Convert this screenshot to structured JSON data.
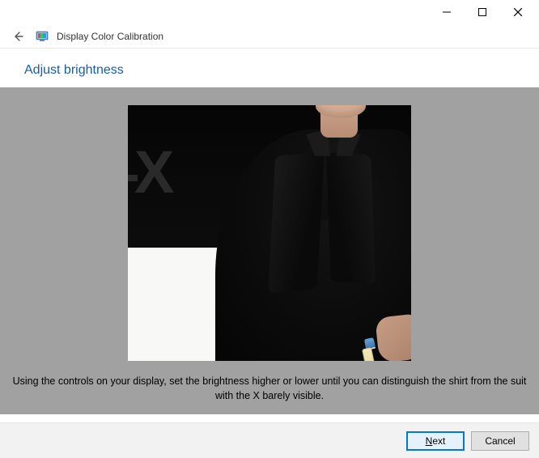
{
  "window": {
    "minimize_label": "Minimize",
    "maximize_label": "Maximize",
    "close_label": "Close"
  },
  "header": {
    "app_title": "Display Color Calibration",
    "back_label": "Back"
  },
  "page": {
    "title": "Adjust brightness",
    "instruction": "Using the controls on your display, set the brightness higher or lower until you can distinguish the shirt from the suit with the X barely visible."
  },
  "footer": {
    "next_label": "Next",
    "cancel_label": "Cancel"
  }
}
